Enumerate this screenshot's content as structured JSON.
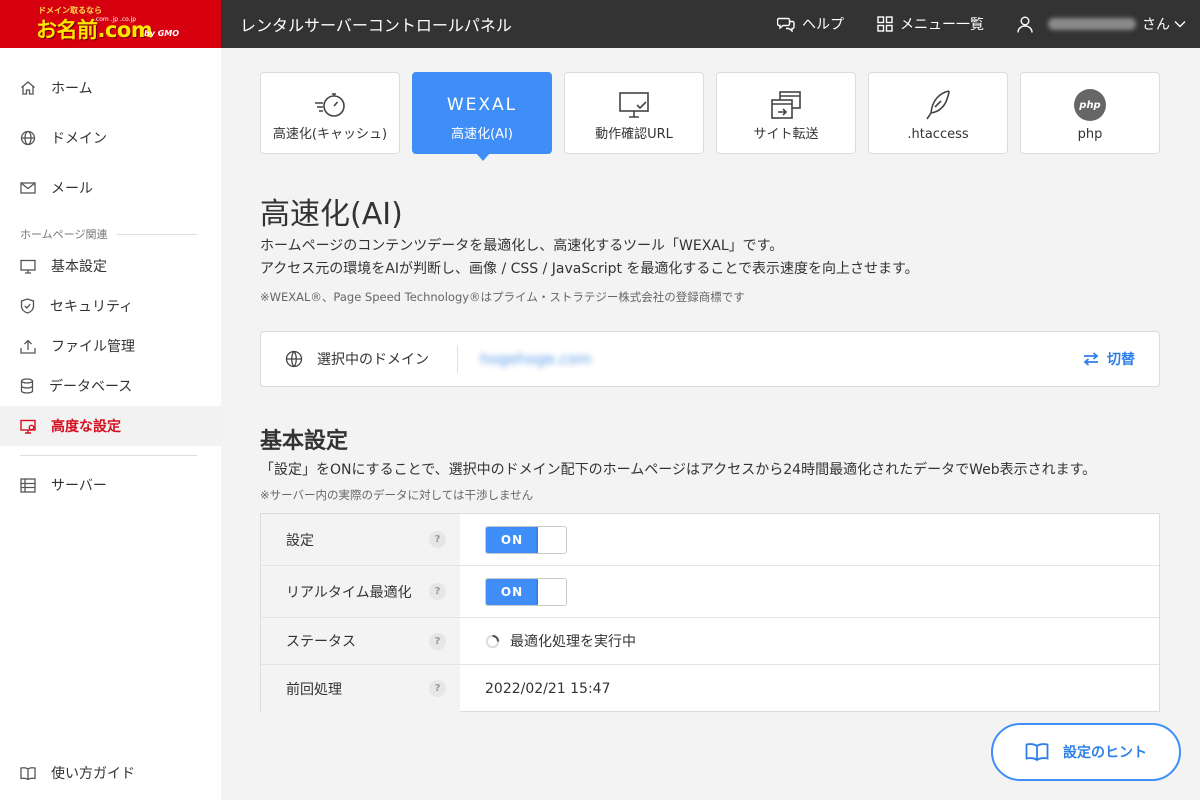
{
  "header": {
    "logo_tagline": "ドメイン取るなら",
    "logo_text": "お名前.com",
    "logo_domains": ".com .jp .co.jp",
    "logo_brand": "by GMO",
    "app_title": "レンタルサーバーコントロールパネル",
    "help_label": "ヘルプ",
    "menu_label": "メニュー一覧",
    "user_suffix": "さん"
  },
  "sidebar": {
    "items": [
      {
        "label": "ホーム",
        "icon": "home-icon"
      },
      {
        "label": "ドメイン",
        "icon": "globe-icon"
      },
      {
        "label": "メール",
        "icon": "mail-icon"
      }
    ],
    "section_label": "ホームページ関連",
    "hp_items": [
      {
        "label": "基本設定",
        "icon": "monitor-icon"
      },
      {
        "label": "セキュリティ",
        "icon": "shield-icon"
      },
      {
        "label": "ファイル管理",
        "icon": "upload-icon"
      },
      {
        "label": "データベース",
        "icon": "database-icon"
      },
      {
        "label": "高度な設定",
        "icon": "settings-monitor-icon",
        "active": true
      }
    ],
    "server_label": "サーバー",
    "guide_label": "使い方ガイド"
  },
  "tabs": [
    {
      "label": "高速化(キャッシュ)",
      "icon": "stopwatch-icon"
    },
    {
      "label": "高速化(AI)",
      "logo": "WEXAL",
      "active": true
    },
    {
      "label": "動作確認URL",
      "icon": "monitor-check-icon"
    },
    {
      "label": "サイト転送",
      "icon": "forward-windows-icon"
    },
    {
      "label": ".htaccess",
      "icon": "feather-icon"
    },
    {
      "label": "php",
      "icon": "php-icon",
      "icon_text": "php"
    }
  ],
  "main": {
    "title": "高速化(AI)",
    "desc_line1": "ホームページのコンテンツデータを最適化し、高速化するツール「WEXAL」です。",
    "desc_line2": "アクセス元の環境をAIが判断し、画像 / CSS / JavaScript を最適化することで表示速度を向上させます。",
    "trademark_note": "※WEXAL®、Page Speed Technology®はプライム・ストラテジー株式会社の登録商標です",
    "domain": {
      "label": "選択中のドメイン",
      "value": "hogehoge.com",
      "switch_label": "切替"
    },
    "section_title": "基本設定",
    "section_desc": "「設定」をONにすることで、選択中のドメイン配下のホームページはアクセスから24時間最適化されたデータでWeb表示されます。",
    "section_note": "※サーバー内の実際のデータに対しては干渉しません",
    "settings": {
      "help_glyph": "?",
      "setting_label": "設定",
      "setting_value": "ON",
      "realtime_label": "リアルタイム最適化",
      "realtime_value": "ON",
      "status_label": "ステータス",
      "status_value": "最適化処理を実行中",
      "last_label": "前回処理",
      "last_value": "2022/02/21 15:47"
    },
    "hint_button": "設定のヒント"
  },
  "colors": {
    "accent_blue": "#3f8df7",
    "brand_red": "#d6000f",
    "header_bg": "#333333",
    "active_red": "#d50e1f"
  }
}
